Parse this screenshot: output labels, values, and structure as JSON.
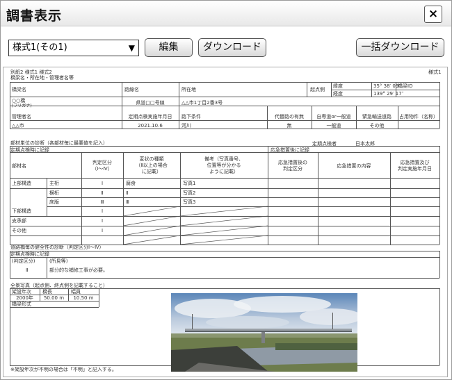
{
  "window": {
    "title": "調書表示",
    "close_label": "×"
  },
  "toolbar": {
    "selected_form": "様式1(その1)",
    "edit_label": "編集",
    "download_label": "ダウンロード",
    "bulk_download_label": "一括ダウンロード"
  },
  "doc": {
    "header_left1": "別紙2 様式1 様式2",
    "header_left2": "橋梁名・所在地・管理者名等",
    "header_right": "様式1",
    "labels": {
      "bridge_name": "橋梁名",
      "route_name": "路線名",
      "location": "所在地",
      "start_point": "起点側",
      "latitude": "緯度",
      "longitude": "経度",
      "bridge_id": "橋梁ID",
      "manager": "管理者名",
      "inspection_date": "定期点検実施年月日",
      "under_condition": "路下条件",
      "detour": "代替路の有無",
      "traffic": "自専道or一般道",
      "emergency_route": "緊急輸送道路",
      "occupancy": "占用物件（名称）"
    },
    "values": {
      "bridge_name": "○○橋",
      "furigana": "(フリガナ)",
      "route_name": "県道□□号線",
      "location": "△△市1丁目2番3号",
      "latitude": "35° 38′ 09″",
      "longitude": "139° 29′ 17″",
      "manager": "△△市",
      "inspection_date": "2021.10.6",
      "under_condition": "河川",
      "detour": "無",
      "traffic": "一般道",
      "emergency_route": "その他"
    },
    "section1": "部材単位の診断（各部材毎に最悪値を記入）",
    "periodic_note": "定期点検時に記録",
    "emergency_note": "応急措置後に記録",
    "inspector_label": "定期点検者",
    "inspector": "日本太郎",
    "col_headers": {
      "member": "部材名",
      "judgement": "判定区分",
      "judgement_range": "（Ⅰ～Ⅳ）",
      "change_reason1": "変状の種類",
      "change_reason2": "（Ⅱ以上の場合",
      "change_reason3": "に記載）",
      "remarks1": "備考（写真番号、",
      "remarks2": "位置等が分かる",
      "remarks3": "ように記載）",
      "post_judgement1": "応急措置後の",
      "post_judgement2": "判定区分",
      "measure_content": "応急措置の内容",
      "measure_date1": "応急措置及び",
      "measure_date2": "判定実施年月日"
    },
    "rows": [
      {
        "group": "上部構造",
        "sub": "主桁",
        "judge": "Ⅰ",
        "kind": "腐食",
        "note": "写真1"
      },
      {
        "group": "",
        "sub": "横桁",
        "judge": "Ⅱ",
        "kind": "Ⅱ",
        "note": "写真2"
      },
      {
        "group": "",
        "sub": "床版",
        "judge": "Ⅲ",
        "kind": "Ⅲ",
        "note": "写真3"
      },
      {
        "group": "下部構造",
        "sub": "",
        "judge": "Ⅰ",
        "kind": "",
        "note": ""
      },
      {
        "group": "支承部",
        "sub": "",
        "judge": "Ⅰ",
        "kind": "",
        "note": ""
      },
      {
        "group": "その他",
        "sub": "",
        "judge": "Ⅰ",
        "kind": "",
        "note": ""
      }
    ],
    "section2": "道路橋毎の健全性の診断（判定区分Ⅰ～Ⅳ）",
    "periodic_note2": "定期点検時に記録",
    "overall_label": "(判定区分)",
    "overall_value": "Ⅱ",
    "findings_label": "(所見等)",
    "findings_text": "部分的な補修工事が必要。",
    "section3": "全景写真（起点側、終点側を記載すること）",
    "spec_headers": {
      "year": "架設年次",
      "length": "橋長",
      "width": "幅員"
    },
    "spec_values": {
      "year": "2000年",
      "length": "50.00 m",
      "width": "10.50 m"
    },
    "bridge_type_label": "橋梁形式",
    "footnote": "※架設年次が不明の場合は「不明」と記入する。"
  }
}
